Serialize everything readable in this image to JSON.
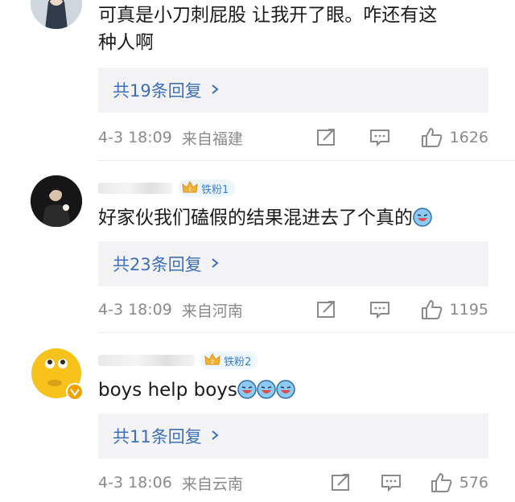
{
  "comments": [
    {
      "text_line1": "可真是小刀刺屁股 让我开了眼。咋还有这",
      "text_line2": "种人啊",
      "replies_label": "共19条回复",
      "time": "4-3 18:09",
      "location": "来自福建",
      "likes": "1626"
    },
    {
      "badge": "铁粉1",
      "text": "好家伙我们磕假的结果混进去了个真的",
      "replies_label": "共23条回复",
      "time": "4-3 18:09",
      "location": "来自河南",
      "likes": "1195"
    },
    {
      "badge": "铁粉2",
      "text": "boys help boys",
      "replies_label": "共11条回复",
      "time": "4-3 18:06",
      "location": "来自云南",
      "likes": "576"
    }
  ],
  "icons": {
    "reply_chevron": "chevron-right-icon",
    "share": "share-icon",
    "comment": "comment-icon",
    "like": "thumbs-up-icon",
    "fan_badge": "crown-icon",
    "verified": "verified-badge-icon",
    "emoji": "laughing-face-emoji"
  },
  "colors": {
    "link_blue": "#3d6fb8",
    "badge_bg": "#eef6fd",
    "meta_gray": "#8a8a8a",
    "verified_orange": "#f2a100"
  }
}
